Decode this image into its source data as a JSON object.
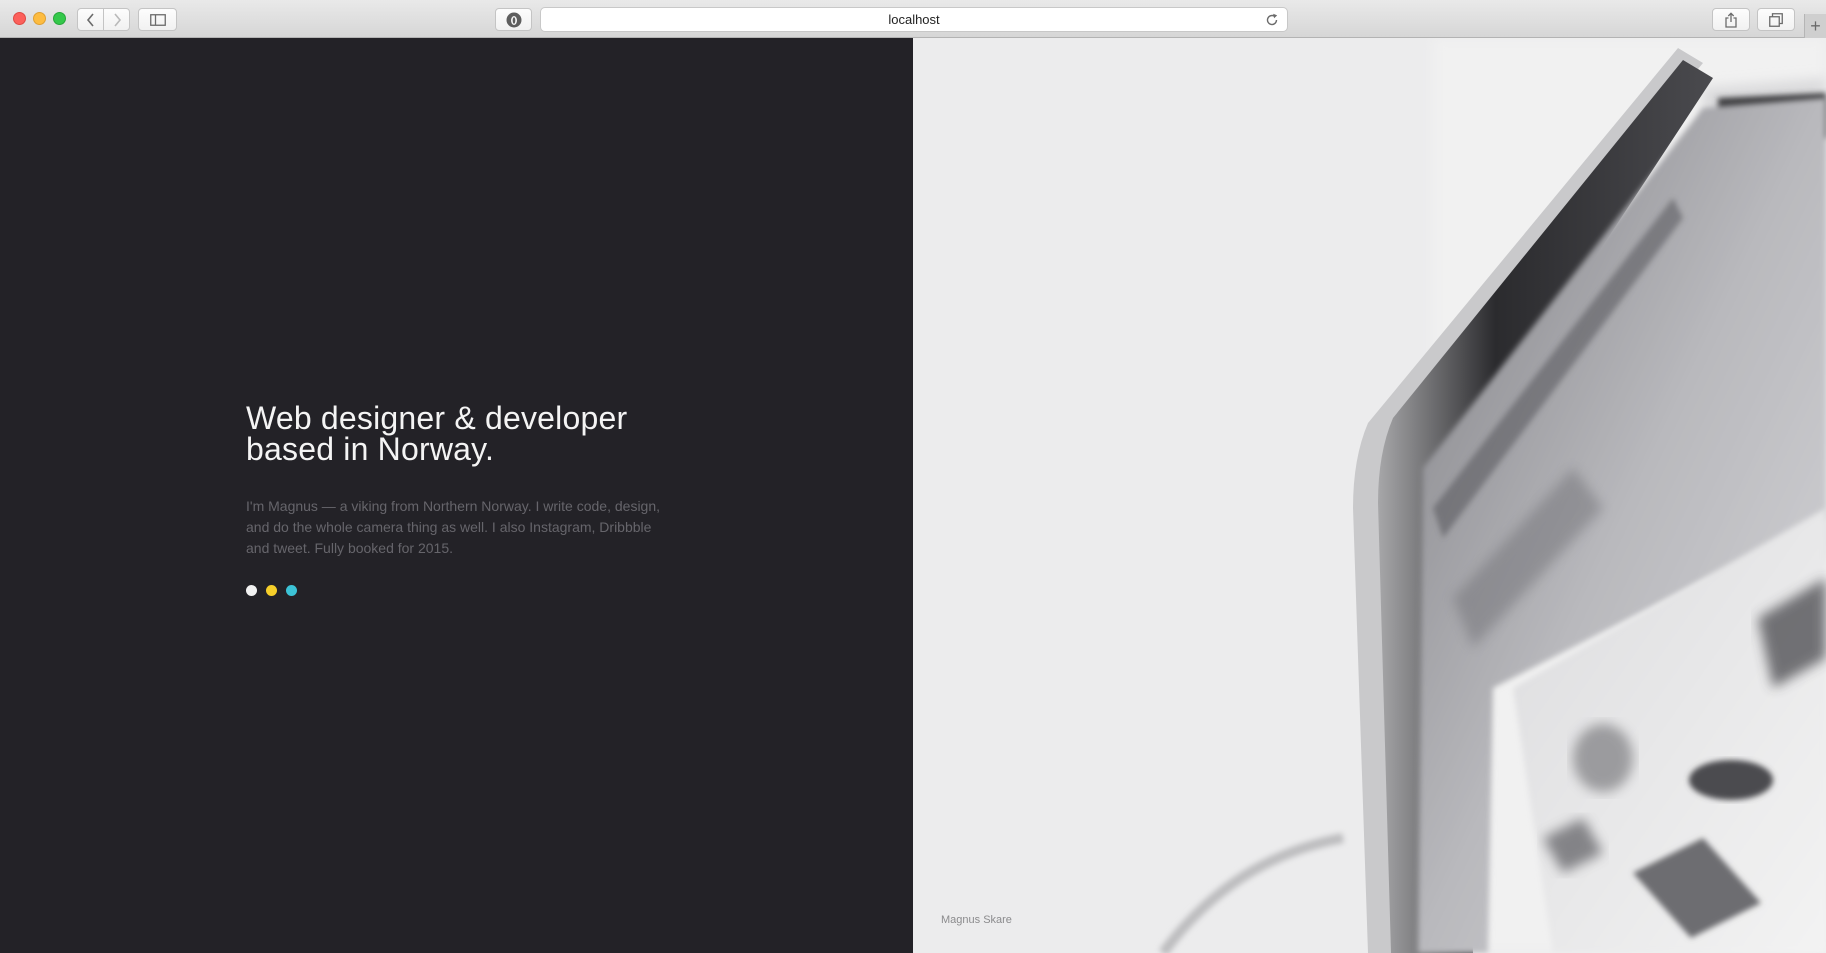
{
  "browser": {
    "url": "localhost"
  },
  "hero": {
    "headline_line1": "Web designer & developer",
    "headline_line2": "based in Norway.",
    "intro": "I'm Magnus — a viking from Northern Norway. I write code, design, and do the whole camera thing as well. I also Instagram, Dribbble and tweet. Fully booked for 2015.",
    "dots": [
      {
        "color": "#f2f2f2",
        "icon": "white-dot"
      },
      {
        "color": "#f6cf2a",
        "icon": "yellow-dot"
      },
      {
        "color": "#3cc3d6",
        "icon": "cyan-dot"
      }
    ]
  },
  "photo": {
    "credit": "Magnus Skare"
  },
  "colors": {
    "left_background": "#232227",
    "headline": "#f4f4f4",
    "intro_text": "#66656b"
  }
}
